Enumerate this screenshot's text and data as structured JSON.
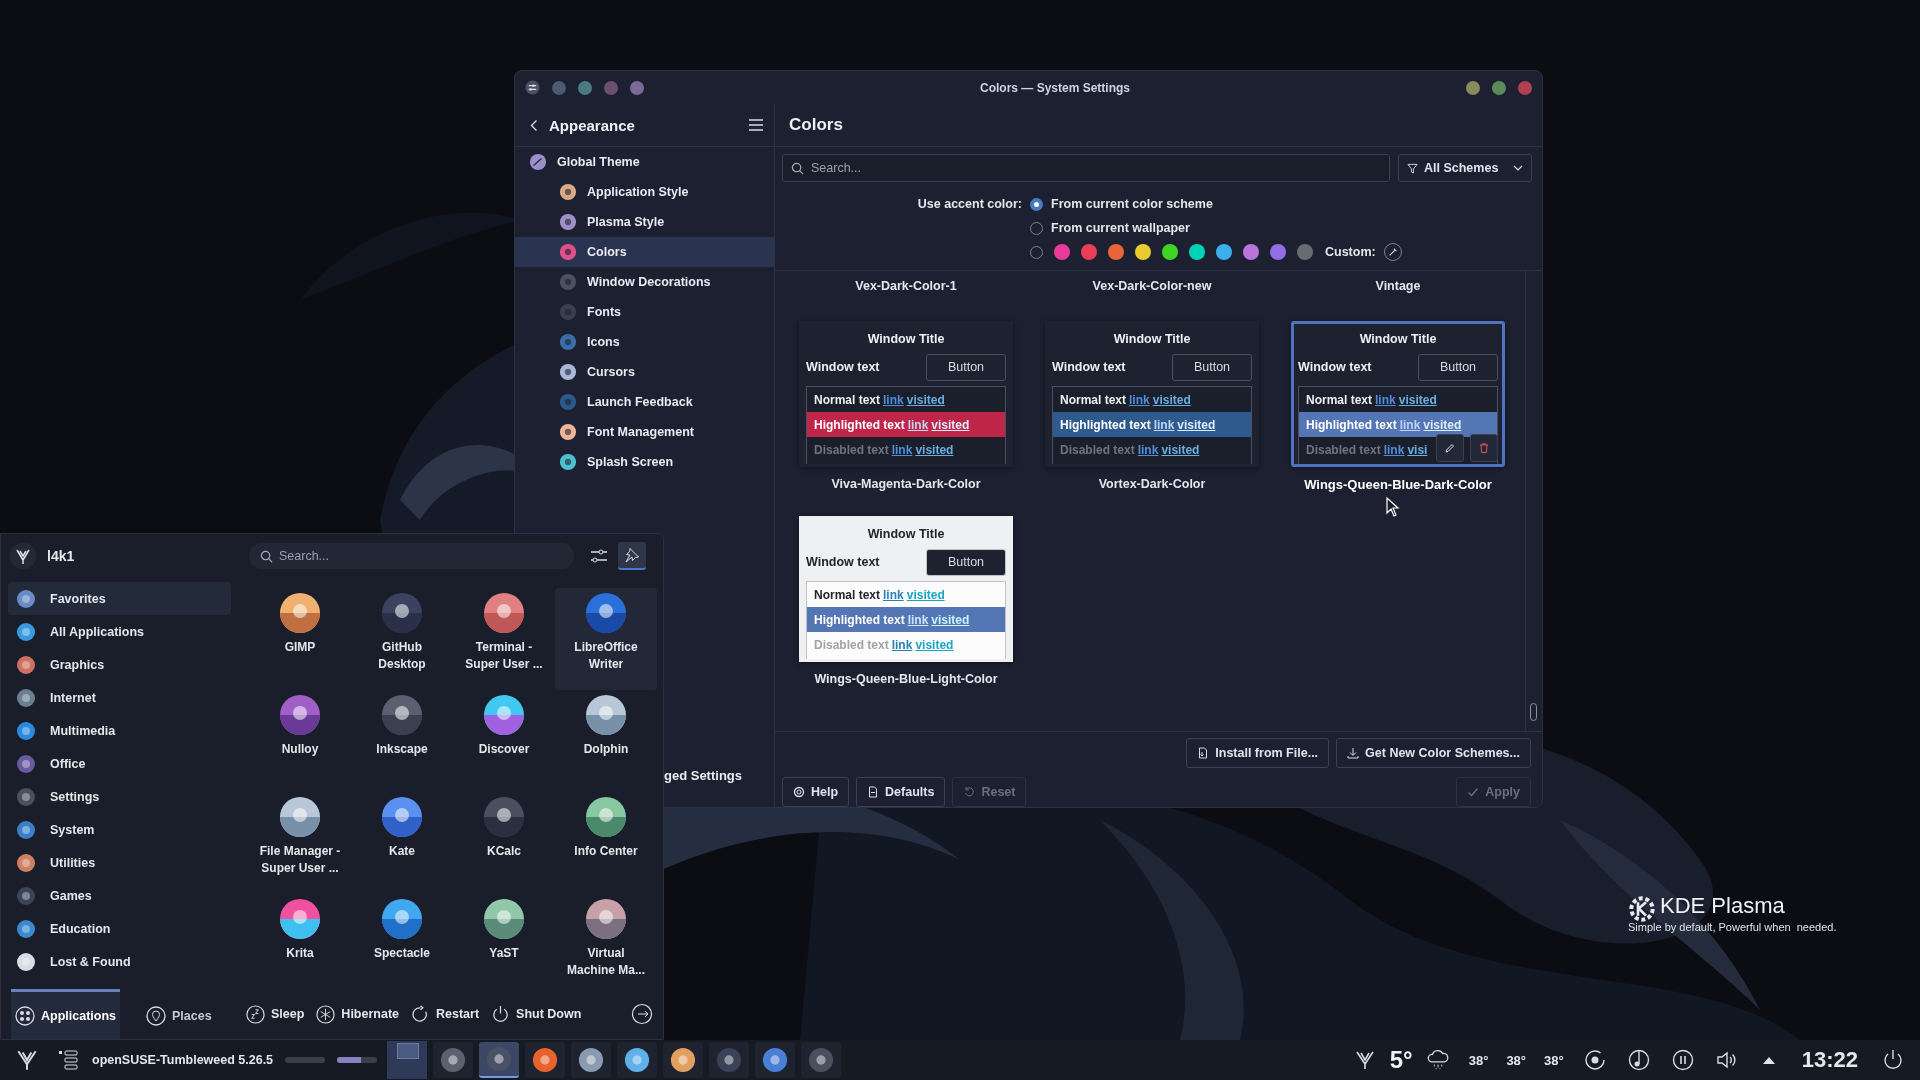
{
  "window": {
    "title": "Colors — System Settings"
  },
  "sidebar": {
    "heading": "Appearance",
    "items": [
      {
        "label": "Global Theme",
        "selected": false,
        "children": [
          {
            "label": "Application Style",
            "selected": false
          },
          {
            "label": "Plasma Style",
            "selected": false
          },
          {
            "label": "Colors",
            "selected": true
          },
          {
            "label": "Window Decorations",
            "selected": false
          },
          {
            "label": "Fonts",
            "selected": false
          },
          {
            "label": "Icons",
            "selected": false
          },
          {
            "label": "Cursors",
            "selected": false
          },
          {
            "label": "Launch Feedback",
            "selected": false
          },
          {
            "label": "Font Management",
            "selected": false
          },
          {
            "label": "Splash Screen",
            "selected": false
          }
        ]
      }
    ],
    "footer_button": "ged Settings"
  },
  "page": {
    "title": "Colors",
    "search": {
      "placeholder": "Search..."
    },
    "filter": "All Schemes",
    "accent": {
      "label": "Use accent color:",
      "options": [
        {
          "label": "From current color scheme",
          "selected": true
        },
        {
          "label": "From current wallpaper",
          "selected": false
        }
      ],
      "custom_radio_selected": false,
      "swatches": [
        {
          "color": "#e93a9a"
        },
        {
          "color": "#e93d58"
        },
        {
          "color": "#e9643a"
        },
        {
          "color": "#e8cb2d"
        },
        {
          "color": "#3dd425"
        },
        {
          "color": "#00d3b8"
        },
        {
          "color": "#3daee9"
        },
        {
          "color": "#b875dc"
        },
        {
          "color": "#926ee4"
        },
        {
          "color": "#686b6f"
        }
      ],
      "custom_label": "Custom:"
    },
    "schemes": [
      {
        "kind": "name-only",
        "name": "Vex-Dark-Color-1"
      },
      {
        "kind": "name-only",
        "name": "Vex-Dark-Color-new"
      },
      {
        "kind": "name-only",
        "name": "Vintage"
      },
      {
        "kind": "preview",
        "name": "Viva-Magenta-Dark-Color",
        "light": false,
        "color": "#c0254a",
        "selected": false,
        "hovered": false,
        "window_title": "Window Title",
        "window_text": "Window text",
        "button": "Button",
        "rows": [
          {
            "kind": "normal",
            "text": "Normal text",
            "link": "link",
            "visited": "visited"
          },
          {
            "kind": "highlighted",
            "text": "Highlighted text",
            "link": "link",
            "visited": "visited"
          },
          {
            "kind": "disabled",
            "text": "Disabled text",
            "link": "link",
            "visited": "visited"
          }
        ]
      },
      {
        "kind": "preview",
        "name": "Vortex-Dark-Color",
        "light": false,
        "color": "#2f5a8e",
        "selected": false,
        "hovered": false,
        "window_title": "Window Title",
        "window_text": "Window text",
        "button": "Button",
        "rows": [
          {
            "kind": "normal",
            "text": "Normal text",
            "link": "link",
            "visited": "visited"
          },
          {
            "kind": "highlighted",
            "text": "Highlighted text",
            "link": "link",
            "visited": "visited"
          },
          {
            "kind": "disabled",
            "text": "Disabled text",
            "link": "link",
            "visited": "visited"
          }
        ]
      },
      {
        "kind": "preview",
        "name": "Wings-Queen-Blue-Dark-Color",
        "light": false,
        "color": "#5576b4",
        "selected": true,
        "hovered": true,
        "window_title": "Window Title",
        "window_text": "Window text",
        "button": "Button",
        "rows": [
          {
            "kind": "normal",
            "text": "Normal text",
            "link": "link",
            "visited": "visited"
          },
          {
            "kind": "highlighted",
            "text": "Highlighted text",
            "link": "link",
            "visited": "visited"
          },
          {
            "kind": "disabled",
            "text": "Disabled text",
            "link": "link",
            "visited": "visi"
          }
        ]
      },
      {
        "kind": "preview",
        "name": "Wings-Queen-Blue-Light-Color",
        "light": true,
        "color": "#5576b4",
        "selected": false,
        "hovered": false,
        "window_title": "Window Title",
        "window_text": "Window text",
        "button": "Button",
        "rows": [
          {
            "kind": "normal",
            "text": "Normal text",
            "link": "link",
            "visited": "visited"
          },
          {
            "kind": "highlighted",
            "text": "Highlighted text",
            "link": "link",
            "visited": "visited"
          },
          {
            "kind": "disabled",
            "text": "Disabled text",
            "link": "link",
            "visited": "visited"
          }
        ]
      }
    ],
    "actions": [
      {
        "kind": "install",
        "label": "Install from File..."
      },
      {
        "kind": "download",
        "label": "Get New Color Schemes..."
      }
    ],
    "footer": [
      {
        "kind": "help",
        "label": "Help",
        "disabled": false
      },
      {
        "kind": "defaults",
        "label": "Defaults",
        "disabled": false
      },
      {
        "kind": "reset",
        "label": "Reset",
        "disabled": true
      },
      {
        "kind": "apply",
        "label": "Apply",
        "disabled": true
      }
    ]
  },
  "launcher": {
    "user": "l4k1",
    "search": {
      "placeholder": "Search..."
    },
    "pinned": true,
    "categories": [
      {
        "label": "Favorites",
        "selected": true
      },
      {
        "label": "All Applications",
        "selected": false
      },
      {
        "label": "Graphics",
        "selected": false
      },
      {
        "label": "Internet",
        "selected": false
      },
      {
        "label": "Multimedia",
        "selected": false
      },
      {
        "label": "Office",
        "selected": false
      },
      {
        "label": "Settings",
        "selected": false
      },
      {
        "label": "System",
        "selected": false
      },
      {
        "label": "Utilities",
        "selected": false
      },
      {
        "label": "Games",
        "selected": false
      },
      {
        "label": "Education",
        "selected": false
      },
      {
        "label": "Lost & Found",
        "selected": false
      }
    ],
    "apps": [
      {
        "label": "GIMP",
        "hovered": false
      },
      {
        "label": "GitHub Desktop",
        "hovered": false
      },
      {
        "label": "Terminal - Super User ...",
        "hovered": false
      },
      {
        "label": "LibreOffice Writer",
        "hovered": true
      },
      {
        "label": "Nulloy",
        "hovered": false
      },
      {
        "label": "Inkscape",
        "hovered": false
      },
      {
        "label": "Discover",
        "hovered": false
      },
      {
        "label": "Dolphin",
        "hovered": false
      },
      {
        "label": "File Manager - Super User ...",
        "hovered": false
      },
      {
        "label": "Kate",
        "hovered": false
      },
      {
        "label": "KCalc",
        "hovered": false
      },
      {
        "label": "Info Center",
        "hovered": false
      },
      {
        "label": "Krita",
        "hovered": false
      },
      {
        "label": "Spectacle",
        "hovered": false
      },
      {
        "label": "YaST",
        "hovered": false
      },
      {
        "label": "Virtual Machine Ma...",
        "hovered": false
      }
    ],
    "tabs": [
      {
        "label": "Applications",
        "selected": true
      },
      {
        "label": "Places",
        "selected": false
      }
    ],
    "power": [
      {
        "kind": "sleep",
        "label": "Sleep"
      },
      {
        "kind": "hibernate",
        "label": "Hibernate"
      },
      {
        "kind": "restart",
        "label": "Restart"
      },
      {
        "kind": "shutdown",
        "label": "Shut Down"
      }
    ]
  },
  "taskbar": {
    "window_title": "openSUSE-Tumbleweed 5.26.5",
    "meters": [
      {
        "level": 0
      },
      {
        "level": 0.6
      }
    ],
    "tasks": [
      {
        "active": false
      },
      {
        "active": true
      },
      {
        "active": false
      },
      {
        "active": false
      },
      {
        "active": false
      },
      {
        "active": false
      },
      {
        "active": false
      },
      {
        "active": false
      },
      {
        "active": false
      }
    ],
    "weather": "5°",
    "temperatures": [
      "38°",
      "38°",
      "38°"
    ],
    "clock": "13:22"
  },
  "desktop": {
    "brand": "KDE Plasma",
    "tagline": "Simple by default, Powerful when  needed."
  }
}
